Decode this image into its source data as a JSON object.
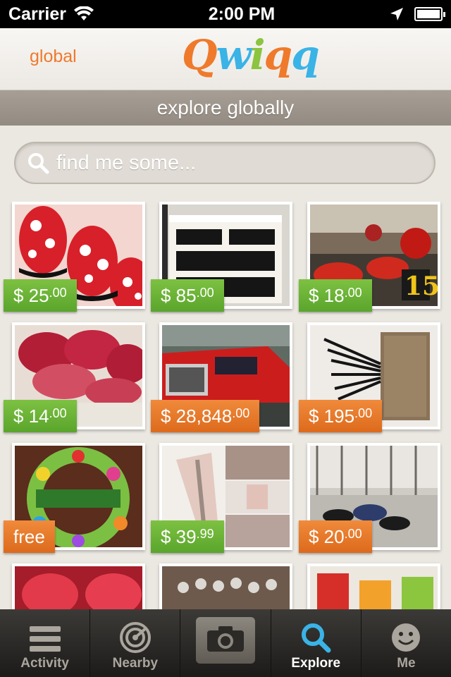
{
  "status": {
    "carrier": "Carrier",
    "time": "2:00 PM"
  },
  "nav": {
    "left_label": "global",
    "logo": "Qwiqq"
  },
  "section": {
    "title": "explore globally"
  },
  "search": {
    "placeholder": "find me some..."
  },
  "items": [
    {
      "price": "$ 25",
      "cents": ".00",
      "color": "green",
      "img": "nails"
    },
    {
      "price": "$ 85",
      "cents": ".00",
      "color": "green",
      "img": "dresser"
    },
    {
      "price": "$ 18",
      "cents": ".00",
      "color": "green",
      "img": "gokarts"
    },
    {
      "price": "$ 14",
      "cents": ".00",
      "color": "green",
      "img": "tuna"
    },
    {
      "price": "$ 28,848",
      "cents": ".00",
      "color": "orange",
      "img": "truck"
    },
    {
      "price": "$ 195",
      "cents": ".00",
      "color": "orange",
      "img": "brushes"
    },
    {
      "price": "free",
      "cents": "",
      "color": "orange",
      "img": "wreath"
    },
    {
      "price": "$ 39",
      "cents": ".99",
      "color": "green",
      "img": "shoes"
    },
    {
      "price": "$ 20",
      "cents": ".00",
      "color": "orange",
      "img": "gym"
    },
    {
      "price": "",
      "cents": "",
      "color": "none",
      "img": "redshoes"
    },
    {
      "price": "",
      "cents": "",
      "color": "none",
      "img": "bracelet"
    },
    {
      "price": "",
      "cents": "",
      "color": "none",
      "img": "drinks"
    }
  ],
  "tabs": [
    {
      "label": "Activity",
      "icon": "list-icon",
      "active": false
    },
    {
      "label": "Nearby",
      "icon": "radar-icon",
      "active": false
    },
    {
      "label": "",
      "icon": "camera-icon",
      "active": false
    },
    {
      "label": "Explore",
      "icon": "search-icon",
      "active": true
    },
    {
      "label": "Me",
      "icon": "smiley-icon",
      "active": false
    }
  ],
  "colors": {
    "orange": "#ef7a2c",
    "blue": "#3ab3e6",
    "green": "#7dc142"
  }
}
